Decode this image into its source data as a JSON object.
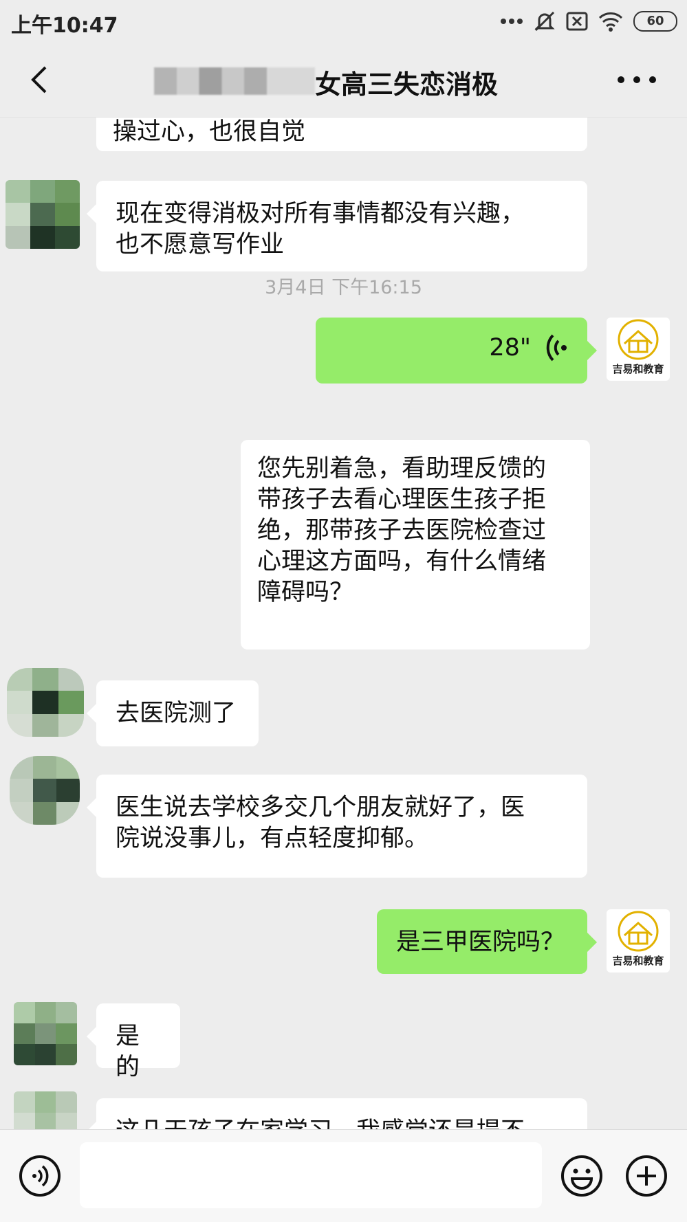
{
  "status_bar": {
    "time": "上午10:47",
    "battery": "60",
    "icons": [
      "more-dots-icon",
      "mute-bell-icon",
      "close-box-icon",
      "wifi-icon",
      "battery-icon"
    ]
  },
  "header": {
    "title_visible": "女高三失恋消极",
    "back_icon": "chevron-left-icon",
    "more_icon": "more-horizontal-icon"
  },
  "messages": [
    {
      "side": "in",
      "type": "text",
      "text": "操过心，也很自觉",
      "clipped": true
    },
    {
      "side": "in",
      "type": "text",
      "lines": [
        "现在变得消极对所有事情都没有兴趣，",
        "也不愿意写作业"
      ]
    },
    {
      "type": "timestamp",
      "text": "3月4日  下午16:15"
    },
    {
      "side": "out",
      "type": "voice",
      "duration": "28\""
    },
    {
      "side": "out",
      "type": "text",
      "lines": [
        "您先别着急，看助理反馈的",
        "带孩子去看心理医生孩子拒",
        "绝，那带孩子去医院检查过",
        "心理这方面吗，有什么情绪",
        "障碍吗？"
      ]
    },
    {
      "side": "in",
      "type": "text",
      "text": "去医院测了"
    },
    {
      "side": "in",
      "type": "text",
      "lines": [
        "医生说去学校多交几个朋友就好了，医",
        "院说没事儿，有点轻度抑郁。"
      ]
    },
    {
      "side": "out",
      "type": "text",
      "text": "是三甲医院吗？"
    },
    {
      "side": "in",
      "type": "text",
      "text": "是的"
    },
    {
      "side": "in",
      "type": "text",
      "text": "这几天孩子在家学习，我感觉还是提不",
      "clipped": true
    }
  ],
  "brand": {
    "name": "吉易和教育",
    "color": "#e2b100"
  },
  "input_bar": {
    "placeholder": "",
    "voice_icon": "voice-toggle-icon",
    "emoji_icon": "emoji-icon",
    "plus_icon": "plus-icon"
  },
  "colors": {
    "background": "#ededed",
    "outgoing_bubble": "#95ec69",
    "incoming_bubble": "#ffffff"
  }
}
